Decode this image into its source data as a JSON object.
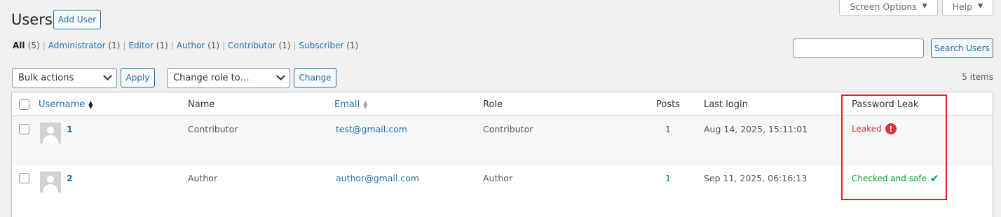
{
  "header": {
    "title": "Users",
    "add_user_label": "Add User",
    "screen_options_label": "Screen Options",
    "help_label": "Help"
  },
  "filters": [
    {
      "label": "All",
      "count": "(5)",
      "current": true
    },
    {
      "label": "Administrator",
      "count": "(1)"
    },
    {
      "label": "Editor",
      "count": "(1)"
    },
    {
      "label": "Author",
      "count": "(1)"
    },
    {
      "label": "Contributor",
      "count": "(1)"
    },
    {
      "label": "Subscriber",
      "count": "(1)"
    }
  ],
  "search": {
    "value": "",
    "button_label": "Search Users"
  },
  "toolbar": {
    "bulk_actions": "Bulk actions",
    "apply_label": "Apply",
    "change_role": "Change role to…",
    "change_label": "Change",
    "items_count": "5 items"
  },
  "columns": {
    "username": "Username",
    "name": "Name",
    "email": "Email",
    "role": "Role",
    "posts": "Posts",
    "last_login": "Last login",
    "password_leak": "Password Leak"
  },
  "rows": [
    {
      "username": "1",
      "name": "Contributor",
      "email": "test@gmail.com",
      "role": "Contributor",
      "posts": "1",
      "last_login": "Aug 14, 2025, 15:11:01",
      "leak_status": "Leaked",
      "leak_icon": "!"
    },
    {
      "username": "2",
      "name": "Author",
      "email": "author@gmail.com",
      "role": "Author",
      "posts": "1",
      "last_login": "Sep 11, 2025, 06:16:13",
      "leak_status": "Checked and safe",
      "leak_icon": "✔"
    }
  ],
  "colors": {
    "accent": "#2271b1",
    "leaked": "#d63638",
    "safe": "#00a32a",
    "highlight": "#e02020"
  }
}
